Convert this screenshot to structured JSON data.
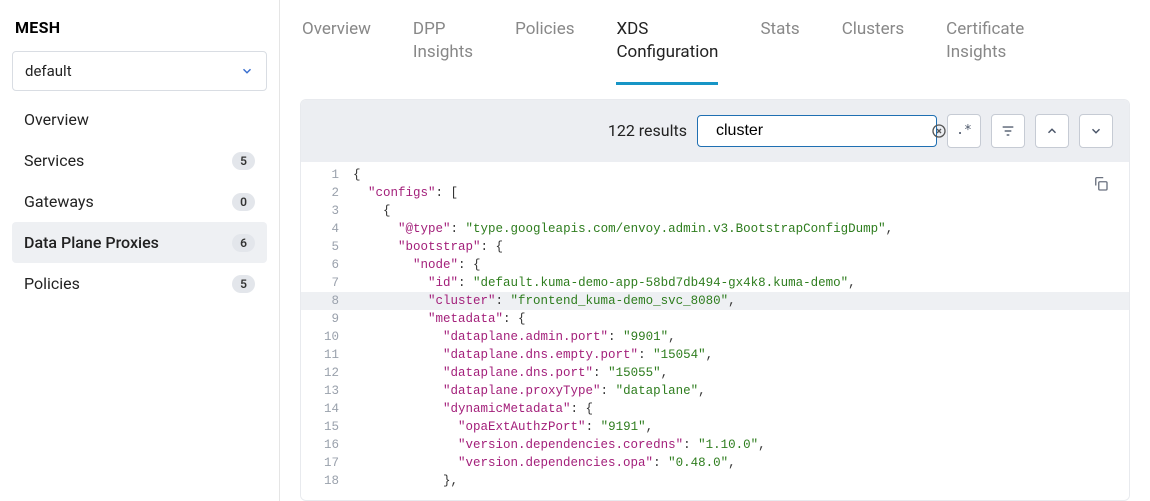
{
  "sidebar": {
    "title": "MESH",
    "selected": "default",
    "items": [
      {
        "label": "Overview",
        "badge": null,
        "active": false
      },
      {
        "label": "Services",
        "badge": "5",
        "active": false
      },
      {
        "label": "Gateways",
        "badge": "0",
        "active": false
      },
      {
        "label": "Data Plane Proxies",
        "badge": "6",
        "active": true
      },
      {
        "label": "Policies",
        "badge": "5",
        "active": false
      }
    ]
  },
  "tabs": [
    {
      "label": "Overview",
      "active": false
    },
    {
      "label": "DPP\nInsights",
      "active": false
    },
    {
      "label": "Policies",
      "active": false
    },
    {
      "label": "XDS\nConfiguration",
      "active": true
    },
    {
      "label": "Stats",
      "active": false
    },
    {
      "label": "Clusters",
      "active": false
    },
    {
      "label": "Certificate\nInsights",
      "active": false
    }
  ],
  "toolbar": {
    "results": "122 results",
    "search_value": "cluster",
    "search_placeholder": "",
    "regex_label": ".*"
  },
  "code": [
    {
      "n": 1,
      "hl": false,
      "tokens": [
        [
          "p",
          "{"
        ]
      ]
    },
    {
      "n": 2,
      "hl": false,
      "tokens": [
        [
          "p",
          "  "
        ],
        [
          "k",
          "\"configs\""
        ],
        [
          "p",
          ": ["
        ]
      ]
    },
    {
      "n": 3,
      "hl": false,
      "tokens": [
        [
          "p",
          "    {"
        ]
      ]
    },
    {
      "n": 4,
      "hl": false,
      "tokens": [
        [
          "p",
          "      "
        ],
        [
          "k",
          "\"@type\""
        ],
        [
          "p",
          ": "
        ],
        [
          "s",
          "\"type.googleapis.com/envoy.admin.v3.BootstrapConfigDump\""
        ],
        [
          "p",
          ","
        ]
      ]
    },
    {
      "n": 5,
      "hl": false,
      "tokens": [
        [
          "p",
          "      "
        ],
        [
          "k",
          "\"bootstrap\""
        ],
        [
          "p",
          ": {"
        ]
      ]
    },
    {
      "n": 6,
      "hl": false,
      "tokens": [
        [
          "p",
          "        "
        ],
        [
          "k",
          "\"node\""
        ],
        [
          "p",
          ": {"
        ]
      ]
    },
    {
      "n": 7,
      "hl": false,
      "tokens": [
        [
          "p",
          "          "
        ],
        [
          "k",
          "\"id\""
        ],
        [
          "p",
          ": "
        ],
        [
          "s",
          "\"default.kuma-demo-app-58bd7db494-gx4k8.kuma-demo\""
        ],
        [
          "p",
          ","
        ]
      ]
    },
    {
      "n": 8,
      "hl": true,
      "tokens": [
        [
          "p",
          "          "
        ],
        [
          "k",
          "\"cluster\""
        ],
        [
          "p",
          ": "
        ],
        [
          "s",
          "\"frontend_kuma-demo_svc_8080\""
        ],
        [
          "p",
          ","
        ]
      ]
    },
    {
      "n": 9,
      "hl": false,
      "tokens": [
        [
          "p",
          "          "
        ],
        [
          "k",
          "\"metadata\""
        ],
        [
          "p",
          ": {"
        ]
      ]
    },
    {
      "n": 10,
      "hl": false,
      "tokens": [
        [
          "p",
          "            "
        ],
        [
          "k",
          "\"dataplane.admin.port\""
        ],
        [
          "p",
          ": "
        ],
        [
          "s",
          "\"9901\""
        ],
        [
          "p",
          ","
        ]
      ]
    },
    {
      "n": 11,
      "hl": false,
      "tokens": [
        [
          "p",
          "            "
        ],
        [
          "k",
          "\"dataplane.dns.empty.port\""
        ],
        [
          "p",
          ": "
        ],
        [
          "s",
          "\"15054\""
        ],
        [
          "p",
          ","
        ]
      ]
    },
    {
      "n": 12,
      "hl": false,
      "tokens": [
        [
          "p",
          "            "
        ],
        [
          "k",
          "\"dataplane.dns.port\""
        ],
        [
          "p",
          ": "
        ],
        [
          "s",
          "\"15055\""
        ],
        [
          "p",
          ","
        ]
      ]
    },
    {
      "n": 13,
      "hl": false,
      "tokens": [
        [
          "p",
          "            "
        ],
        [
          "k",
          "\"dataplane.proxyType\""
        ],
        [
          "p",
          ": "
        ],
        [
          "s",
          "\"dataplane\""
        ],
        [
          "p",
          ","
        ]
      ]
    },
    {
      "n": 14,
      "hl": false,
      "tokens": [
        [
          "p",
          "            "
        ],
        [
          "k",
          "\"dynamicMetadata\""
        ],
        [
          "p",
          ": {"
        ]
      ]
    },
    {
      "n": 15,
      "hl": false,
      "tokens": [
        [
          "p",
          "              "
        ],
        [
          "k",
          "\"opaExtAuthzPort\""
        ],
        [
          "p",
          ": "
        ],
        [
          "s",
          "\"9191\""
        ],
        [
          "p",
          ","
        ]
      ]
    },
    {
      "n": 16,
      "hl": false,
      "tokens": [
        [
          "p",
          "              "
        ],
        [
          "k",
          "\"version.dependencies.coredns\""
        ],
        [
          "p",
          ": "
        ],
        [
          "s",
          "\"1.10.0\""
        ],
        [
          "p",
          ","
        ]
      ]
    },
    {
      "n": 17,
      "hl": false,
      "tokens": [
        [
          "p",
          "              "
        ],
        [
          "k",
          "\"version.dependencies.opa\""
        ],
        [
          "p",
          ": "
        ],
        [
          "s",
          "\"0.48.0\""
        ],
        [
          "p",
          ","
        ]
      ]
    },
    {
      "n": 18,
      "hl": false,
      "tokens": [
        [
          "p",
          "            },"
        ]
      ]
    }
  ]
}
